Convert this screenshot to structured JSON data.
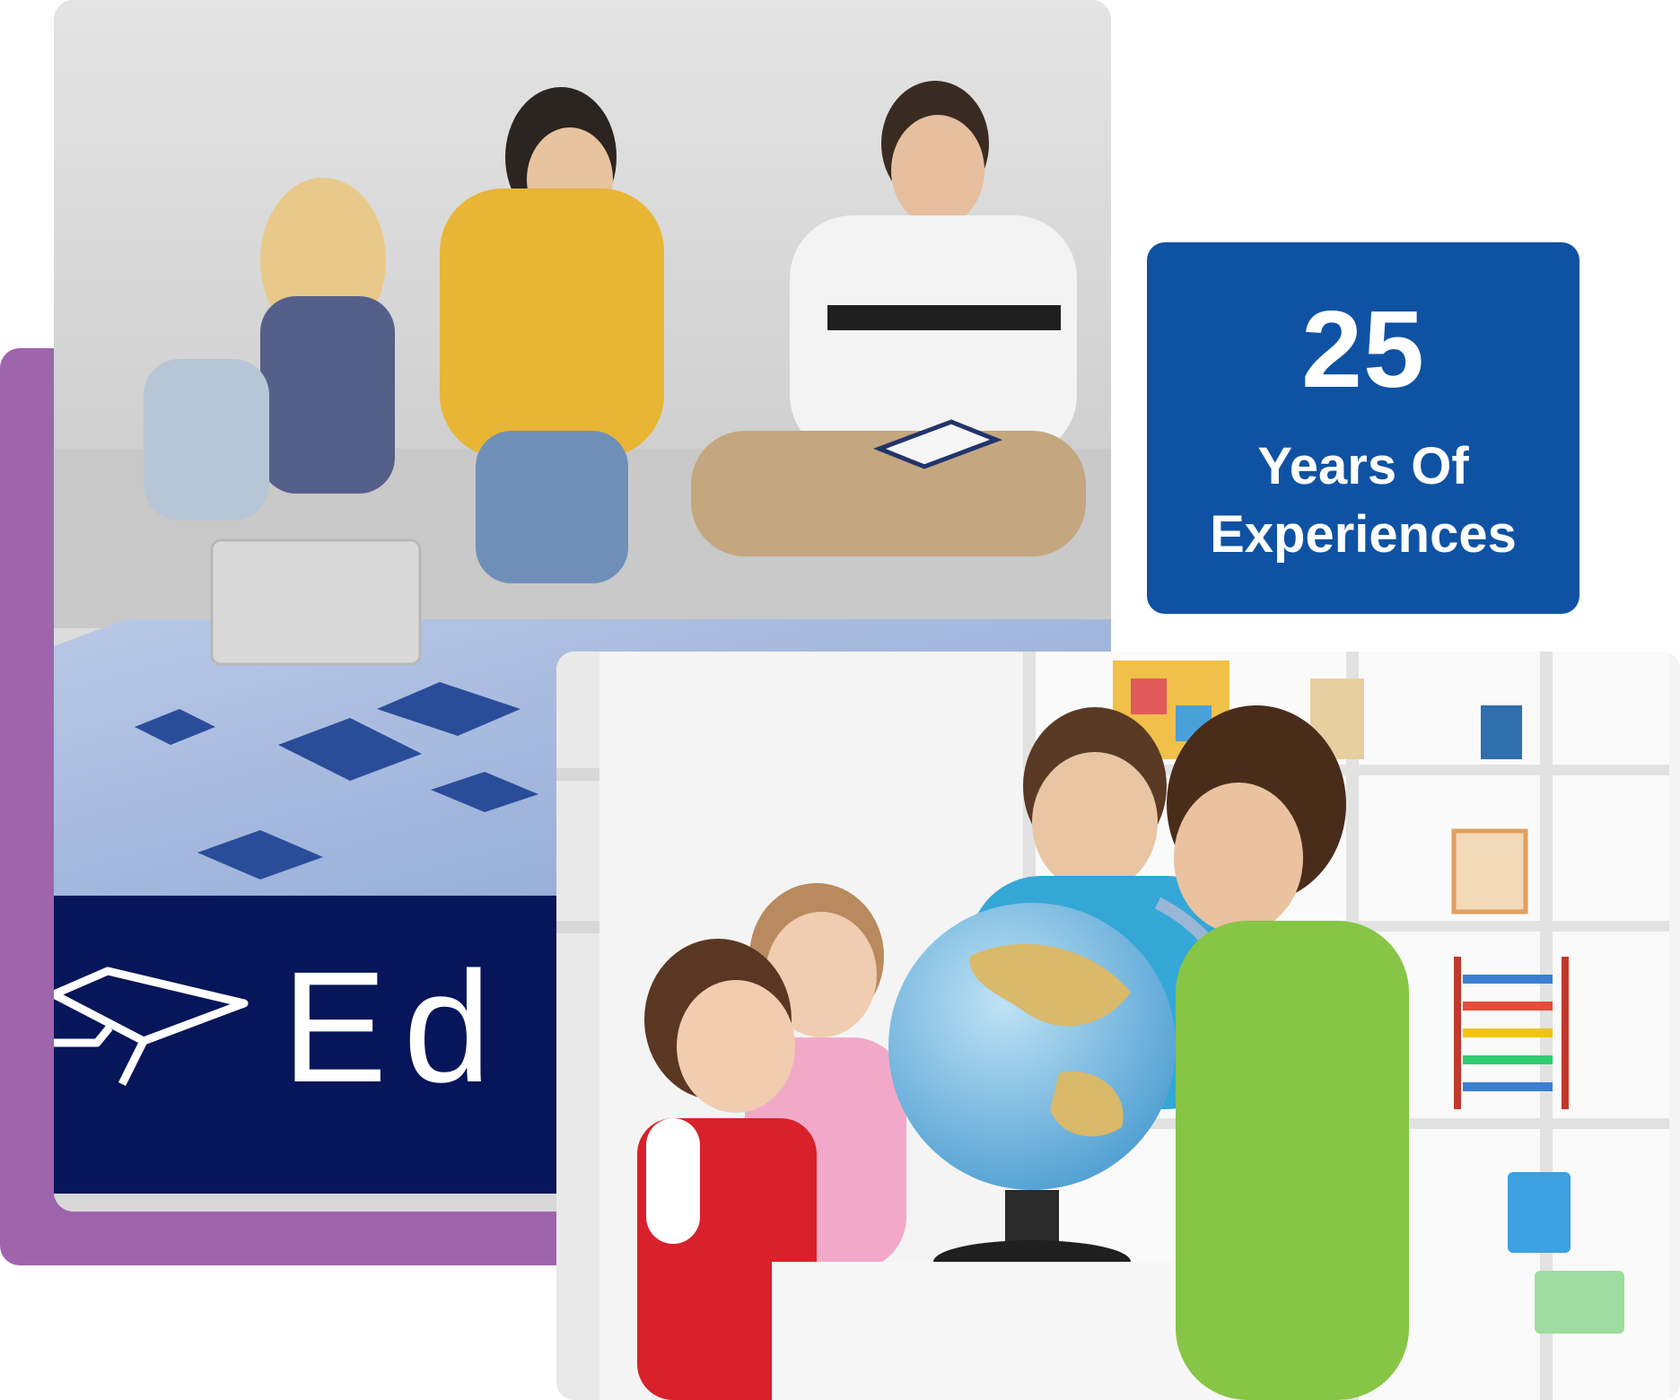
{
  "experience": {
    "number": "25",
    "line1": "Years Of",
    "line2": "Experiences"
  },
  "banner": {
    "text": "Ed"
  },
  "colors": {
    "badge_background": "#0f52a3",
    "badge_text": "#ffffff",
    "backdrop_purple": "#9e65ad",
    "banner_navy": "#07155a"
  },
  "images": [
    {
      "name": "students-studying-photo"
    },
    {
      "name": "kids-globe-photo"
    }
  ]
}
